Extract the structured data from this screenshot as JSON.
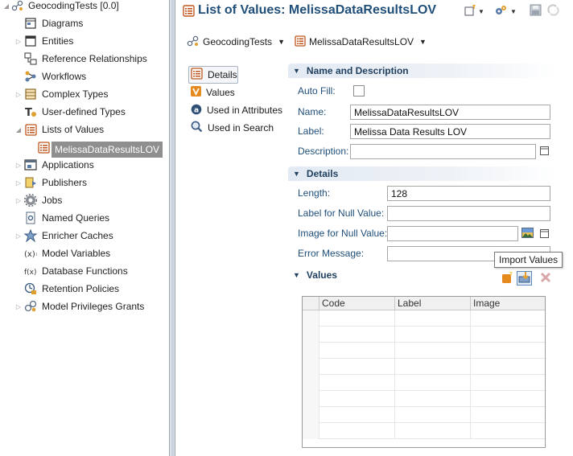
{
  "tree": {
    "items": [
      {
        "label": "GeocodingTests [0.0]",
        "icon": "model-icon",
        "twistie": "expanded",
        "indent": 0
      },
      {
        "label": "Diagrams",
        "icon": "diagrams-icon",
        "twistie": "",
        "indent": 1
      },
      {
        "label": "Entities",
        "icon": "entities-icon",
        "twistie": "collapsed",
        "indent": 1
      },
      {
        "label": "Reference Relationships",
        "icon": "reference-relationships-icon",
        "twistie": "",
        "indent": 1
      },
      {
        "label": "Workflows",
        "icon": "workflows-icon",
        "twistie": "",
        "indent": 1
      },
      {
        "label": "Complex Types",
        "icon": "complex-types-icon",
        "twistie": "collapsed",
        "indent": 1
      },
      {
        "label": "User-defined Types",
        "icon": "user-defined-types-icon",
        "twistie": "",
        "indent": 1
      },
      {
        "label": "Lists of Values",
        "icon": "lists-of-values-icon",
        "twistie": "expanded",
        "indent": 1
      },
      {
        "label": "MelissaDataResultsLOV",
        "icon": "lov-icon",
        "twistie": "",
        "indent": 2,
        "selected": true
      },
      {
        "label": "Applications",
        "icon": "applications-icon",
        "twistie": "collapsed",
        "indent": 1
      },
      {
        "label": "Publishers",
        "icon": "publishers-icon",
        "twistie": "collapsed",
        "indent": 1
      },
      {
        "label": "Jobs",
        "icon": "jobs-icon",
        "twistie": "collapsed",
        "indent": 1
      },
      {
        "label": "Named Queries",
        "icon": "named-queries-icon",
        "twistie": "",
        "indent": 1
      },
      {
        "label": "Enricher Caches",
        "icon": "enricher-caches-icon",
        "twistie": "collapsed",
        "indent": 1
      },
      {
        "label": "Model Variables",
        "icon": "model-variables-icon",
        "twistie": "",
        "indent": 1
      },
      {
        "label": "Database Functions",
        "icon": "database-functions-icon",
        "twistie": "",
        "indent": 1
      },
      {
        "label": "Retention Policies",
        "icon": "retention-policies-icon",
        "twistie": "",
        "indent": 1
      },
      {
        "label": "Model Privileges Grants",
        "icon": "model-privileges-grants-icon",
        "twistie": "collapsed",
        "indent": 1
      }
    ]
  },
  "editor": {
    "title": "List of Values: MelissaDataResultsLOV",
    "crumbs": [
      {
        "label": "GeocodingTests",
        "icon": "model-icon"
      },
      {
        "label": "MelissaDataResultsLOV",
        "icon": "lov-icon"
      }
    ],
    "nav": [
      {
        "label": "Details",
        "icon": "details-icon",
        "active": true
      },
      {
        "label": "Values",
        "icon": "values-icon"
      },
      {
        "label": "Used in Attributes",
        "icon": "used-in-attributes-icon"
      },
      {
        "label": "Used in Search",
        "icon": "used-in-search-icon"
      }
    ],
    "name_section": {
      "title": "Name and Description",
      "auto_fill_label": "Auto Fill:",
      "auto_fill_checked": false,
      "name_label": "Name:",
      "name_value": "MelissaDataResultsLOV",
      "label_label": "Label:",
      "label_value": "Melissa Data Results LOV",
      "description_label": "Description:",
      "description_value": ""
    },
    "details_section": {
      "title": "Details",
      "length_label": "Length:",
      "length_value": "128",
      "null_label_label": "Label for Null Value:",
      "null_label_value": "",
      "null_image_label": "Image for Null Value:",
      "null_image_value": "",
      "error_label": "Error Message:",
      "error_value": ""
    },
    "values_section": {
      "title": "Values",
      "tooltip": "Import Values",
      "columns": [
        "Code",
        "Label",
        "Image"
      ],
      "rows": []
    }
  },
  "colors": {
    "title": "#1f4e79",
    "section_header": "#1f3f5f",
    "selection": "#8f8f8f"
  }
}
